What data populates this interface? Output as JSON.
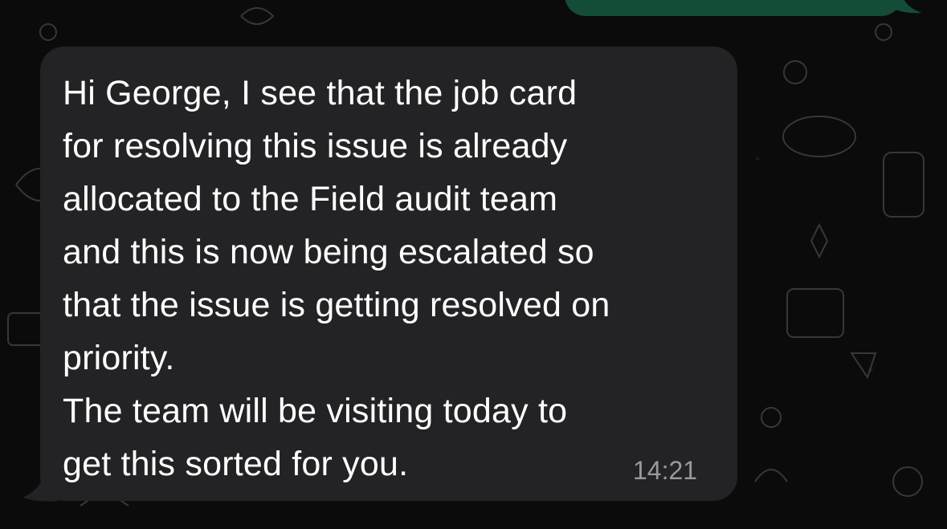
{
  "colors": {
    "background": "#0b0b0b",
    "incoming_bubble": "#232325",
    "outgoing_bubble": "#144d37",
    "message_text": "#ffffff",
    "timestamp_text": "#9a9a9e"
  },
  "messages": {
    "incoming": {
      "text": "Hi George, I see that the job card\nfor resolving this issue is already\nallocated to the Field audit team\nand this is now being escalated so\nthat the issue is getting resolved on\npriority.\nThe team will be visiting today to\nget this sorted for you.",
      "time": "14:21"
    }
  }
}
